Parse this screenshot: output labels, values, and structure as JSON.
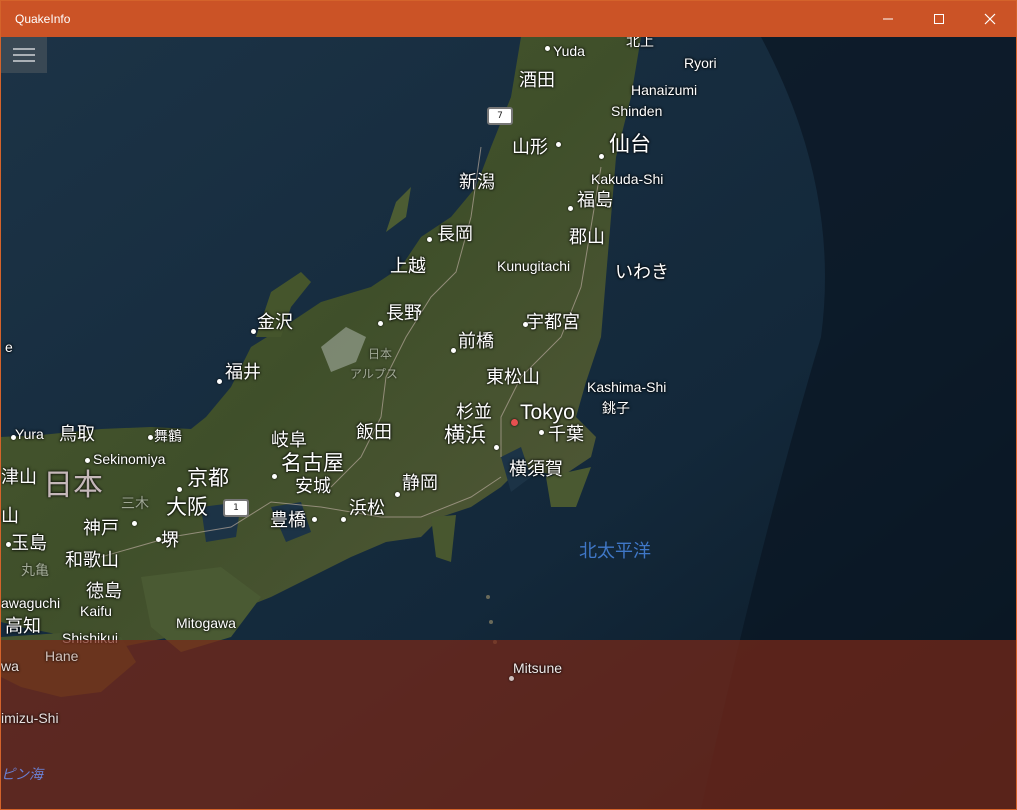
{
  "window": {
    "title": "QuakeInfo",
    "accent_color": "#cb5326",
    "buttons": [
      "minimize-icon",
      "maximize-icon",
      "close-icon"
    ]
  },
  "menu": {
    "icon": "hamburger-menu-icon"
  },
  "map": {
    "type": "satellite-aerial",
    "labels": {
      "yuda": "Yuda",
      "hokujo": "北上",
      "ryori": "Ryori",
      "sakata": "酒田",
      "hanaizumi": "Hanaizumi",
      "shinden": "Shinden",
      "yamagata": "山形",
      "sendai": "仙台",
      "niigata": "新潟",
      "kakuda": "Kakuda-Shi",
      "fukushima": "福島",
      "nagaoka": "長岡",
      "koriyama": "郡山",
      "joetsu": "上越",
      "kunugitachi": "Kunugitachi",
      "iwaki": "いわき",
      "nagano": "長野",
      "kanazawa": "金沢",
      "utsunomiya": "宇都宮",
      "maebashi": "前橋",
      "nihon_small": "日本",
      "alps": "アルプス",
      "fukui": "福井",
      "higashimatsuyama": "東松山",
      "kashima": "Kashima-Shi",
      "choshi": "銚子",
      "suginami": "杉並",
      "tokyo": "Tokyo",
      "yura": "Yura",
      "tottori": "鳥取",
      "maizuru": "舞鶴",
      "iida": "飯田",
      "gifu": "岐阜",
      "yokohama": "横浜",
      "chiba": "千葉",
      "sekinomiya": "Sekinomiya",
      "nagoya": "名古屋",
      "yokosuka": "横須賀",
      "nihon_region": "日本",
      "kyoto": "京都",
      "anjo": "安城",
      "shizuoka": "静岡",
      "yama1": "津山",
      "sanki": "三木",
      "osaka": "大阪",
      "hamamatsu": "浜松",
      "toyohashi": "豊橋",
      "yama2": "山",
      "kobe": "神戸",
      "tamashima": "玉島",
      "sakai": "堺",
      "pacific": "北太平洋",
      "marugame": "丸亀",
      "wakayama": "和歌山",
      "tokushima": "徳島",
      "kawaguchi": "awaguchi",
      "kaifu": "Kaifu",
      "mitogawa": "Mitogawa",
      "kochi": "高知",
      "shishikui": "Shishikui",
      "hane": "Hane",
      "wa": "wa",
      "mitsune": "Mitsune",
      "shimizu": "imizu-Shi",
      "philippine_sea": "ピン海",
      "e_edge": "e"
    },
    "routes": [
      "7",
      "1"
    ]
  }
}
